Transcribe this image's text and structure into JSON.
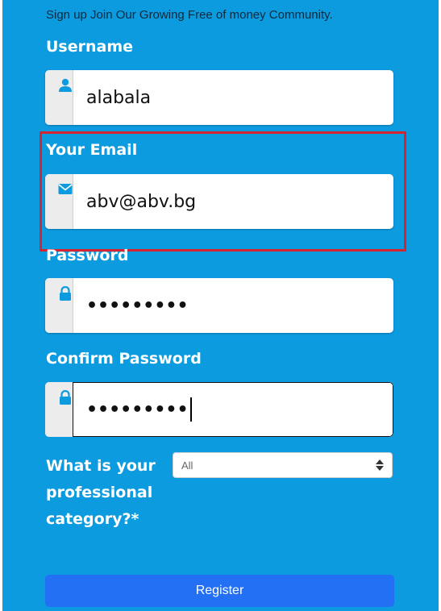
{
  "intro_text": "Sign up Join Our Growing Free of money Community.",
  "username": {
    "label": "Username",
    "value": "alabala",
    "icon": "user-icon"
  },
  "email": {
    "label": "Your Email",
    "value": "abv@abv.bg",
    "icon": "envelope-icon"
  },
  "password": {
    "label": "Password",
    "value": "•••••••••",
    "icon": "lock-icon"
  },
  "confirm_password": {
    "label": "Confirm Password",
    "value": "•••••••••",
    "icon": "lock-icon"
  },
  "category": {
    "question": "What is your professional category?*",
    "selected": "All"
  },
  "register_label": "Register",
  "colors": {
    "panel_bg": "#0d9be0",
    "button_bg": "#2470f5",
    "highlight": "#d6232e",
    "icon": "#0d9be0"
  }
}
